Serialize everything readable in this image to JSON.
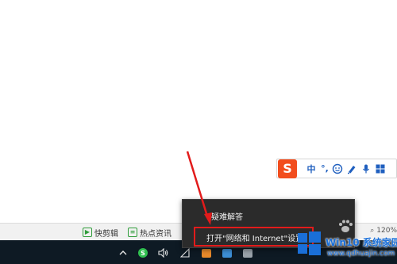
{
  "ime_toolbar": {
    "logo_letter": "S",
    "mode_label": "中",
    "punct_label": "°,",
    "icons": [
      "emoji-icon",
      "skin-icon",
      "microphone-icon",
      "grid-icon"
    ]
  },
  "status_bar": {
    "quick_clip_label": "快剪辑",
    "hot_news_label": "热点资讯",
    "zoom_label": "120%"
  },
  "context_menu": {
    "items": [
      {
        "label": "疑难解答"
      },
      {
        "label": "打开\"网络和 Internet\"设置"
      }
    ]
  },
  "taskbar": {
    "tray_icons": [
      "chevron-up-icon",
      "sogou-tray-icon",
      "volume-icon",
      "network-icon",
      "app-icon-orange",
      "app-icon-blue",
      "app-icon-gray"
    ]
  },
  "watermark": {
    "title": "Win10 系统家园",
    "url": "www.qdhuajin.com"
  },
  "colors": {
    "highlight_red": "#e21b1b",
    "taskbar_bg": "#0e1a24",
    "menu_bg": "#2b2b2b",
    "sogou_orange": "#f24d1d"
  }
}
